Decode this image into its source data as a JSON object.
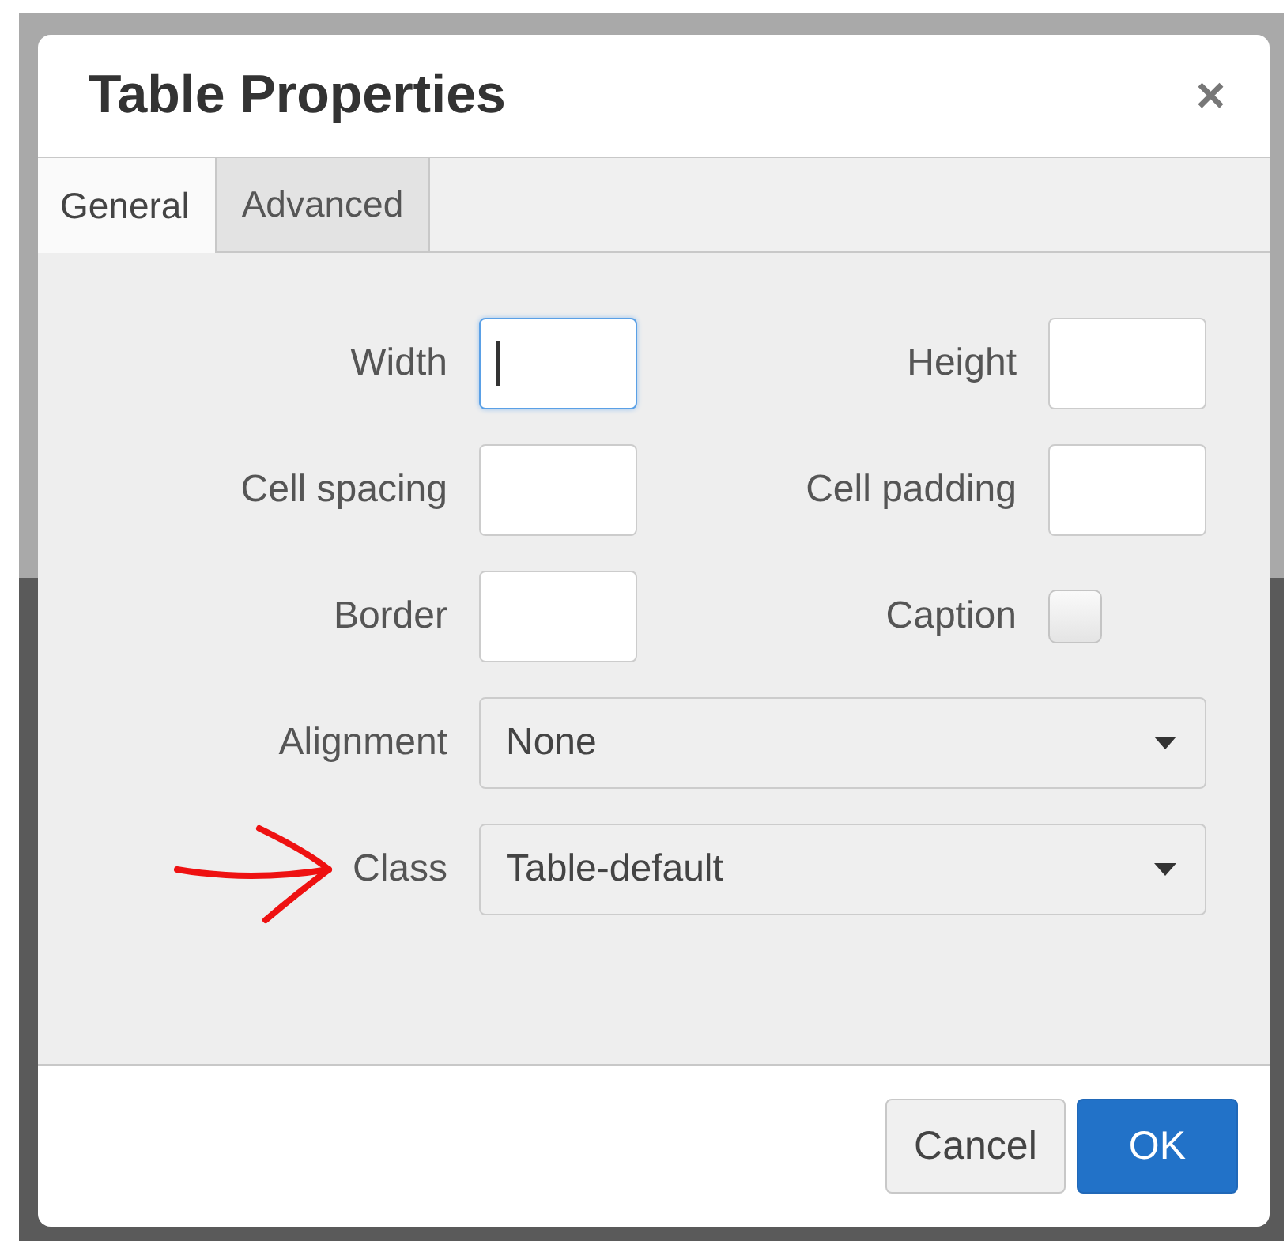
{
  "dialog": {
    "title": "Table Properties",
    "close": "×"
  },
  "tabs": [
    {
      "label": "General",
      "selected": true
    },
    {
      "label": "Advanced",
      "selected": false
    }
  ],
  "fields": [
    {
      "kind": "text",
      "label": "Width",
      "focused": true
    },
    {
      "kind": "text",
      "label": "Height",
      "focused": false
    },
    {
      "kind": "text",
      "label": "Cell spacing",
      "focused": false
    },
    {
      "kind": "text",
      "label": "Cell padding",
      "focused": false
    },
    {
      "kind": "text",
      "label": "Border",
      "focused": false
    },
    {
      "kind": "checkbox",
      "label": "Caption",
      "checked": false
    },
    {
      "kind": "select",
      "label": "Alignment",
      "value": "None"
    },
    {
      "kind": "select",
      "label": "Class",
      "value": "Table-default"
    }
  ],
  "buttons": [
    {
      "label": "Cancel",
      "primary": false
    },
    {
      "label": "OK",
      "primary": true
    }
  ]
}
